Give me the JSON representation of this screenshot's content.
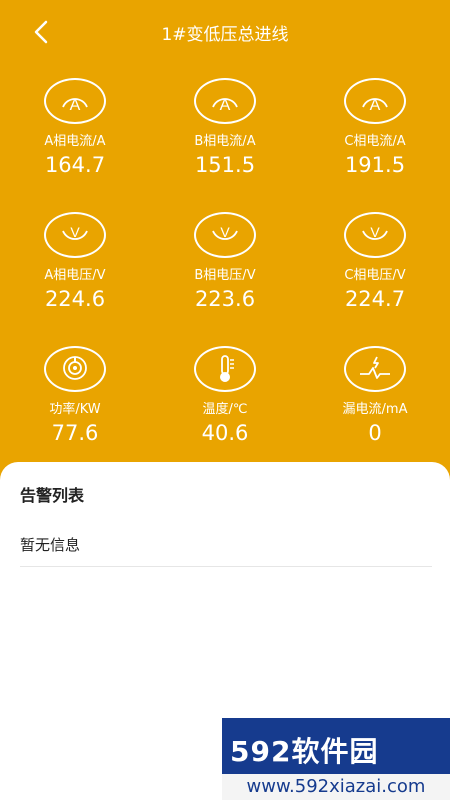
{
  "header": {
    "title": "1#变低压总进线"
  },
  "metrics": [
    {
      "label": "A相电流/A",
      "value": "164.7",
      "icon": "ammeter-icon"
    },
    {
      "label": "B相电流/A",
      "value": "151.5",
      "icon": "ammeter-icon"
    },
    {
      "label": "C相电流/A",
      "value": "191.5",
      "icon": "ammeter-icon"
    },
    {
      "label": "A相电压/V",
      "value": "224.6",
      "icon": "voltmeter-icon"
    },
    {
      "label": "B相电压/V",
      "value": "223.6",
      "icon": "voltmeter-icon"
    },
    {
      "label": "C相电压/V",
      "value": "224.7",
      "icon": "voltmeter-icon"
    },
    {
      "label": "功率/KW",
      "value": "77.6",
      "icon": "power-icon"
    },
    {
      "label": "温度/℃",
      "value": "40.6",
      "icon": "thermometer-icon"
    },
    {
      "label": "漏电流/mA",
      "value": "0",
      "icon": "leakage-current-icon"
    }
  ],
  "alarms": {
    "title": "告警列表",
    "empty_text": "暂无信息"
  },
  "watermark": {
    "brand": "592软件园",
    "url": "www.592xiazai.com"
  },
  "colors": {
    "background": "#e9a400",
    "watermark": "#163b8e"
  }
}
